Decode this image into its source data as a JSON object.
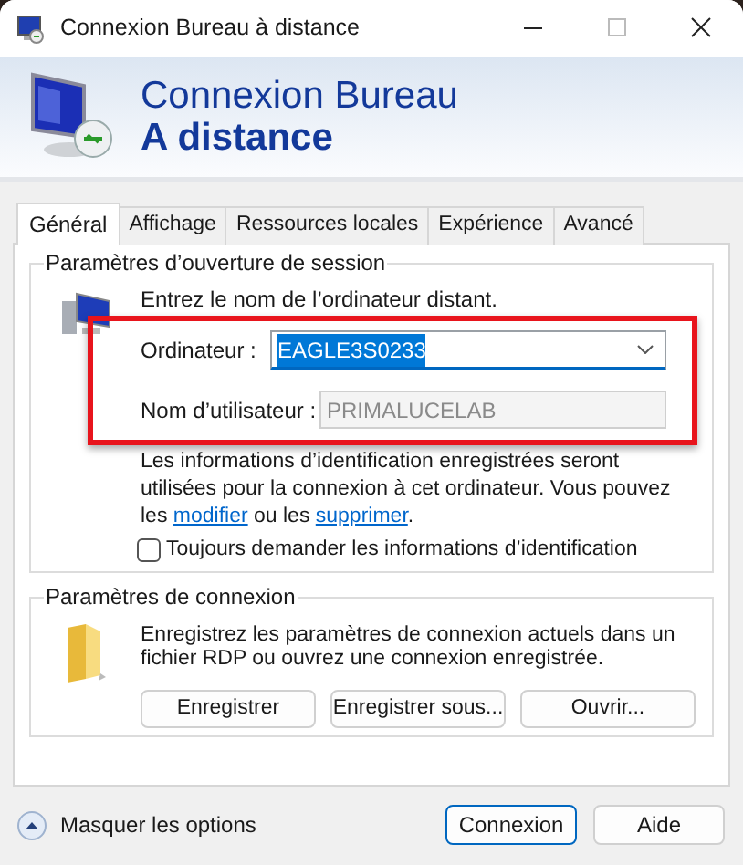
{
  "window": {
    "title": "Connexion Bureau à distance"
  },
  "banner": {
    "line_1": "Connexion Bureau",
    "line_2": "A distance"
  },
  "tabs": [
    {
      "label": "Général",
      "selected": true
    },
    {
      "label": "Affichage",
      "selected": false
    },
    {
      "label": "Ressources locales",
      "selected": false
    },
    {
      "label": "Expérience",
      "selected": false
    },
    {
      "label": "Avancé",
      "selected": false
    }
  ],
  "logon_settings": {
    "title": "Paramètres d’ouverture de session",
    "prompt": "Entrez le nom de l’ordinateur distant.",
    "computer": {
      "label": "Ordinateur :",
      "value": "EAGLE3S0233",
      "focused": true,
      "text_selected": true
    },
    "username": {
      "label": "Nom d’utilisateur :",
      "value": "PRIMALUCELAB",
      "disabled": true
    },
    "info": [
      {
        "kind": "text",
        "text": "Les informations d’identification enregistrées seront utilisées pour la connexion à cet ordinateur. Vous pouvez les "
      },
      {
        "kind": "link",
        "text": "modifier"
      },
      {
        "kind": "text",
        "text": " ou les "
      },
      {
        "kind": "link",
        "text": "supprimer"
      },
      {
        "kind": "text",
        "text": "."
      }
    ],
    "always_ask": {
      "label": "Toujours demander les informations d’identification",
      "checked": false
    }
  },
  "connection_settings": {
    "title": "Paramètres de connexion",
    "text": "Enregistrez les paramètres de connexion actuels dans un fichier RDP ou ouvrez une connexion enregistrée.",
    "buttons": [
      "Enregistrer",
      "Enregistrer sous...",
      "Ouvrir..."
    ]
  },
  "footer": {
    "toggle": "Masquer les options",
    "buttons": [
      {
        "label": "Connexion",
        "default": true
      },
      {
        "label": "Aide",
        "default": false
      }
    ]
  }
}
